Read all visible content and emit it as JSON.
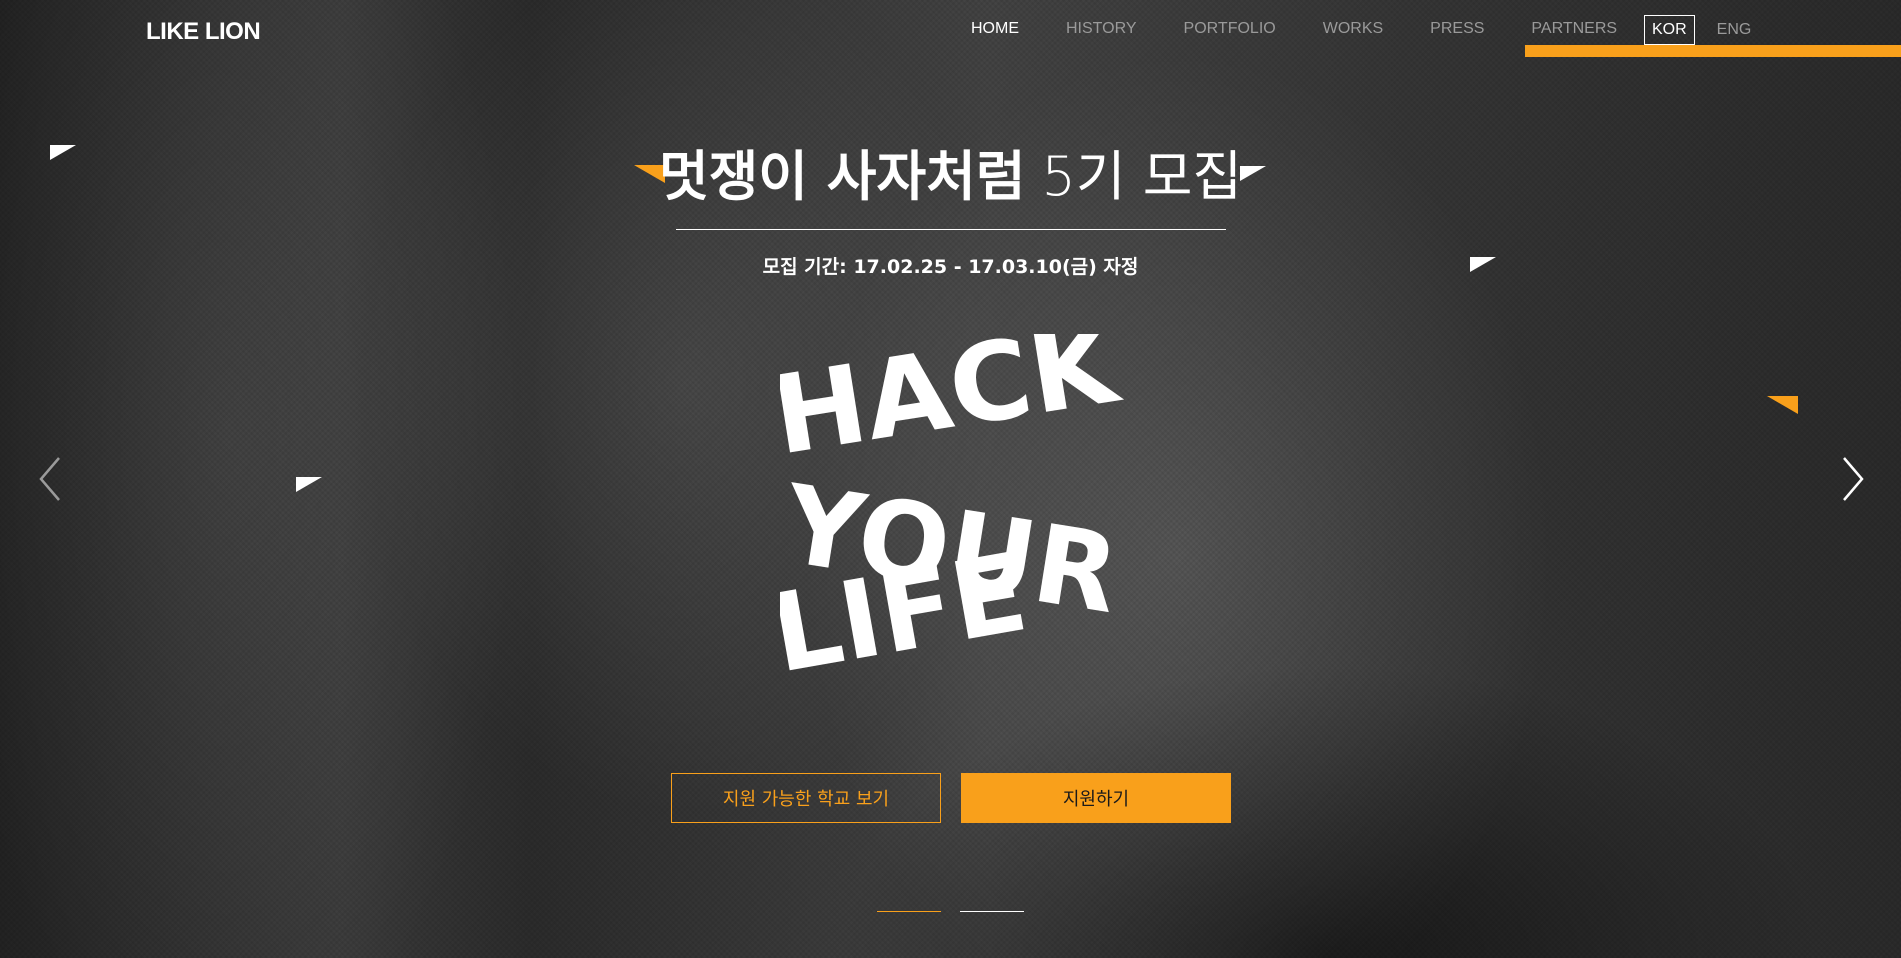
{
  "app": {
    "logo": "LIKE LION"
  },
  "nav": {
    "items": [
      {
        "label": "HOME",
        "active": true
      },
      {
        "label": "HISTORY",
        "active": false
      },
      {
        "label": "PORTFOLIO",
        "active": false
      },
      {
        "label": "WORKS",
        "active": false
      },
      {
        "label": "PRESS",
        "active": false
      },
      {
        "label": "PARTNERS",
        "active": false
      }
    ]
  },
  "language": {
    "kor": "KOR",
    "eng": "ENG",
    "selected": "KOR"
  },
  "hero": {
    "title_bold": "멋쟁이 사자처럼",
    "title_light": "5기 모집",
    "subtitle": "모집 기간: 17.02.25 - 17.03.10(금) 자정",
    "hack_lines": [
      "HACK",
      "YOUR",
      "LIFE"
    ],
    "buttons": {
      "schools": "지원 가능한 학교 보기",
      "apply": "지원하기"
    },
    "slider": {
      "active_index": 0,
      "count": 2
    },
    "icons": {
      "prev": "chevron-left-icon",
      "next": "chevron-right-icon"
    }
  },
  "colors": {
    "accent": "#f9a01b",
    "text": "#ffffff",
    "nav_inactive": "#9a9a9a"
  }
}
